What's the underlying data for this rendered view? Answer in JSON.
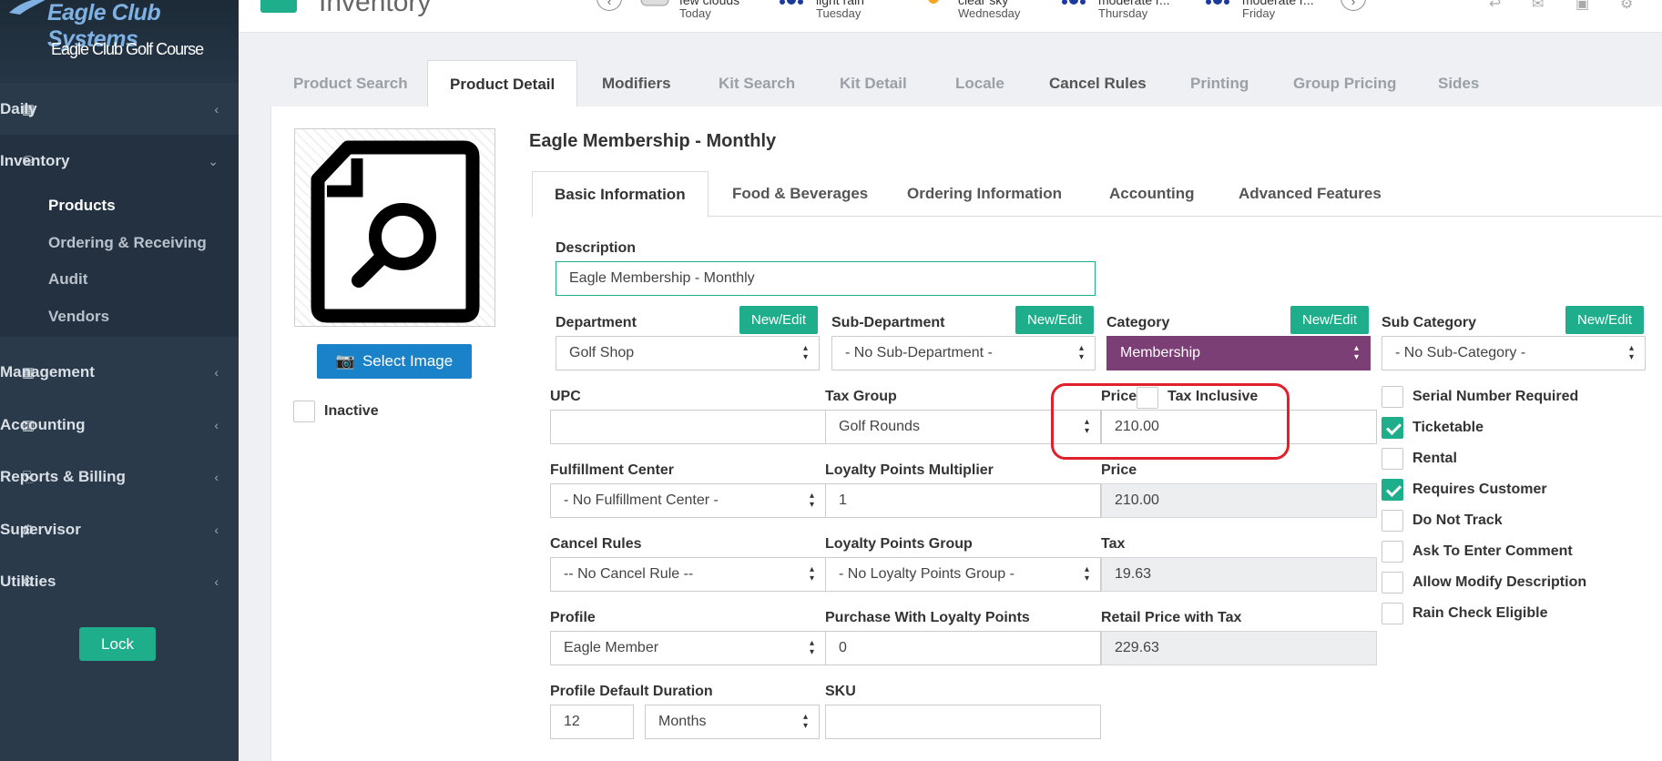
{
  "sidebar": {
    "brand_title": "Eagle Club Systems",
    "brand_subtitle": "Eagle Club Golf Course",
    "nav": {
      "daily": "Daily",
      "inventory": "Inventory",
      "management": "Management",
      "accounting": "Accounting",
      "reports": "Reports & Billing",
      "supervisor": "Supervisor",
      "utilities": "Utilities"
    },
    "inventory_sub": [
      "Products",
      "Ordering & Receiving",
      "Audit",
      "Vendors"
    ],
    "lock_label": "Lock"
  },
  "topbar": {
    "title": "Inventory",
    "weather": [
      {
        "condition": "few clouds",
        "day": "Today"
      },
      {
        "condition": "light rain",
        "day": "Tuesday"
      },
      {
        "condition": "clear sky",
        "day": "Wednesday"
      },
      {
        "condition": "moderate r...",
        "day": "Thursday"
      },
      {
        "condition": "moderate r...",
        "day": "Friday"
      }
    ]
  },
  "main_tabs": [
    "Product Search",
    "Product Detail",
    "Modifiers",
    "Kit Search",
    "Kit Detail",
    "Locale",
    "Cancel Rules",
    "Printing",
    "Group Pricing",
    "Sides"
  ],
  "left_panel": {
    "select_image_label": "Select Image",
    "inactive_label": "Inactive"
  },
  "product": {
    "title": "Eagle Membership - Monthly",
    "inner_tabs": [
      "Basic Information",
      "Food & Beverages",
      "Ordering Information",
      "Accounting",
      "Advanced Features"
    ]
  },
  "form": {
    "new_edit": "New/Edit",
    "description": {
      "label": "Description",
      "value": "Eagle Membership - Monthly"
    },
    "department": {
      "label": "Department",
      "value": "Golf Shop"
    },
    "sub_department": {
      "label": "Sub-Department",
      "value": "- No Sub-Department -"
    },
    "category": {
      "label": "Category",
      "value": "Membership"
    },
    "sub_category": {
      "label": "Sub Category",
      "value": "- No Sub-Category -"
    },
    "upc": {
      "label": "UPC",
      "value": ""
    },
    "tax_group": {
      "label": "Tax Group",
      "value": "Golf Rounds"
    },
    "price_label": "Price",
    "tax_inclusive_label": "Tax Inclusive",
    "price_value": "210.00",
    "fulfillment": {
      "label": "Fulfillment Center",
      "value": "- No Fulfillment Center -"
    },
    "loyalty_multiplier": {
      "label": "Loyalty Points Multiplier",
      "value": "1"
    },
    "price_readonly": {
      "label": "Price",
      "value": "210.00"
    },
    "cancel_rules": {
      "label": "Cancel Rules",
      "value": "-- No Cancel Rule --"
    },
    "loyalty_group": {
      "label": "Loyalty Points Group",
      "value": "- No Loyalty Points Group -"
    },
    "tax": {
      "label": "Tax",
      "value": "19.63"
    },
    "profile": {
      "label": "Profile",
      "value": "Eagle Member"
    },
    "purchase_loyalty": {
      "label": "Purchase With Loyalty Points",
      "value": "0"
    },
    "retail_price_tax": {
      "label": "Retail Price with Tax",
      "value": "229.63"
    },
    "profile_duration": {
      "label": "Profile Default Duration",
      "value": "12",
      "unit": "Months"
    },
    "sku": {
      "label": "SKU",
      "value": ""
    }
  },
  "options": [
    {
      "label": "Serial Number Required",
      "checked": false
    },
    {
      "label": "Ticketable",
      "checked": true
    },
    {
      "label": "Rental",
      "checked": false
    },
    {
      "label": "Requires Customer",
      "checked": true
    },
    {
      "label": "Do Not Track",
      "checked": false
    },
    {
      "label": "Ask To Enter Comment",
      "checked": false
    },
    {
      "label": "Allow Modify Description",
      "checked": false
    },
    {
      "label": "Rain Check Eligible",
      "checked": false
    }
  ],
  "colors": {
    "sidebar": "#2b3a4a",
    "accent_green": "#1fae8b",
    "select_image_blue": "#1a82c9",
    "category_purple": "#7b3e75",
    "highlight_red": "#e0202a"
  }
}
